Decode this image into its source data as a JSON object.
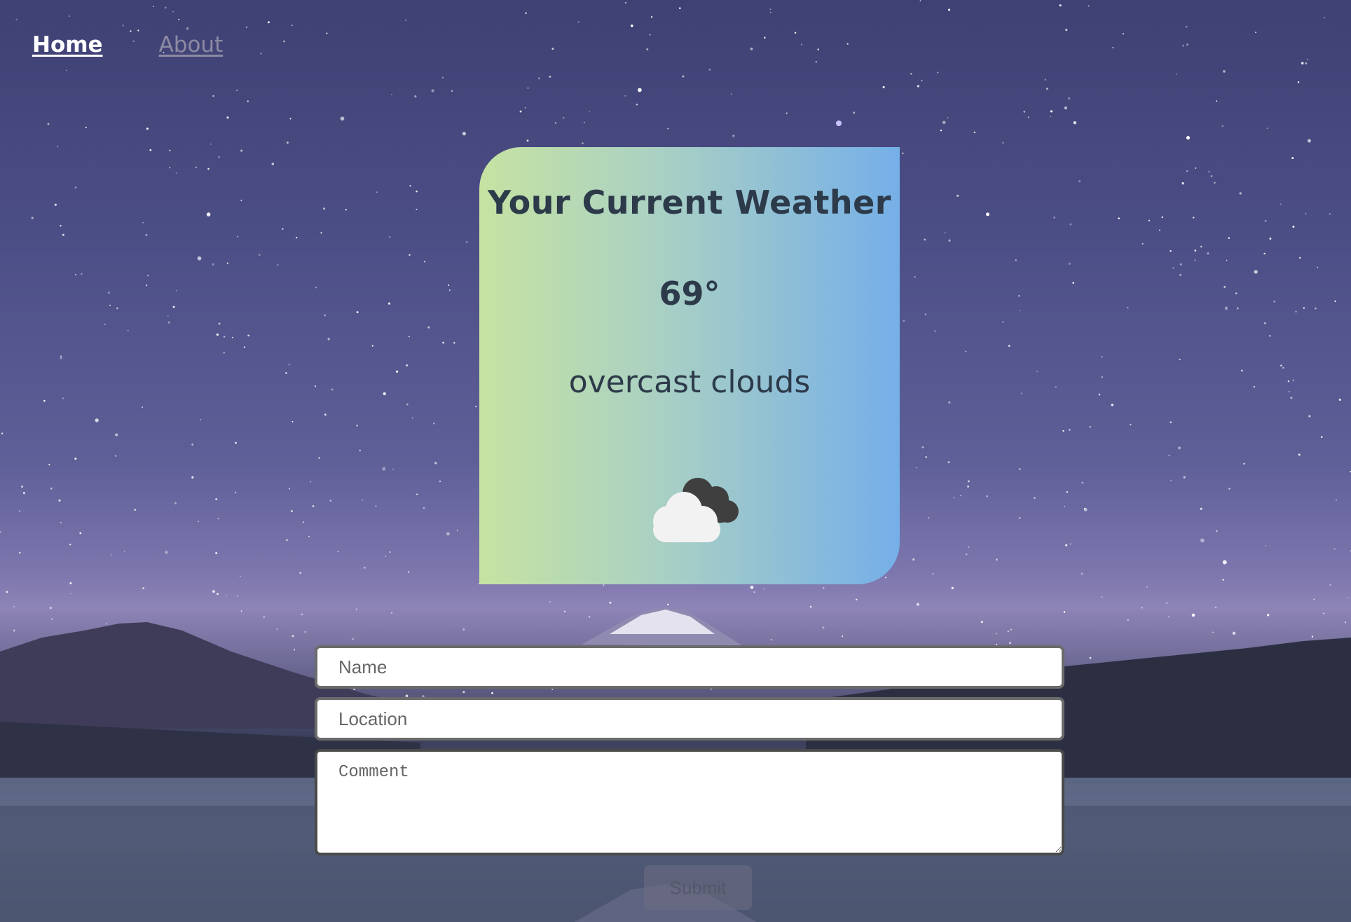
{
  "nav": {
    "home_label": "Home",
    "about_label": "About"
  },
  "weather": {
    "title": "Your Current Weather",
    "temperature": "69°",
    "description": "overcast clouds",
    "icon": "overcast-clouds-icon"
  },
  "form": {
    "name_placeholder": "Name",
    "location_placeholder": "Location",
    "comment_placeholder": "Comment",
    "submit_label": "Submit"
  },
  "colors": {
    "card_gradient_start": "#c6e3a2",
    "card_gradient_end": "#75afe8",
    "card_text": "#2d3a4a",
    "nav_active": "#ffffff",
    "nav_inactive": "#8d8aa3"
  }
}
